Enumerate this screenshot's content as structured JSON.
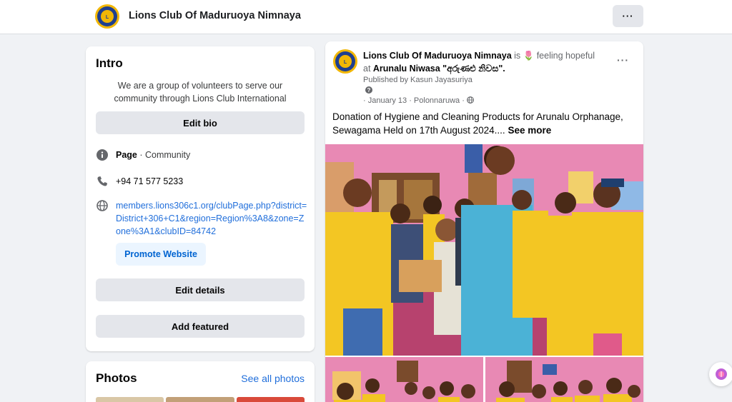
{
  "topbar": {
    "page_name": "Lions Club Of Maduruoya Nimnaya",
    "more_label": "···"
  },
  "intro": {
    "title": "Intro",
    "bio": "We are a group of volunteers to serve our community through Lions Club International",
    "edit_bio": "Edit bio",
    "category_label": "Page",
    "category_value": " · Community",
    "phone": "+94 71 577 5233",
    "website": "members.lions306c1.org/clubPage.php?district=District+306+C1&region=Region%3A8&zone=Zone%3A1&clubID=84742",
    "promote_website": "Promote Website",
    "edit_details": "Edit details",
    "add_featured": "Add featured"
  },
  "photos": {
    "title": "Photos",
    "see_all": "See all photos"
  },
  "post": {
    "author": "Lions Club Of Maduruoya Nimnaya",
    "feeling_prefix": " is ",
    "feeling_emoji": "🌷",
    "feeling": " feeling hopeful",
    "at_prefix": "at ",
    "location": "Arunalu Niwasa \"අරුණළු නිවස\".",
    "published_by": "Published by Kasun Jayasuriya",
    "help_icon_glyph": "?",
    "meta": "· January 13 · Polonnaruwa ·",
    "more_label": "···",
    "body": "Donation of Hygiene and Cleaning Products for Arunalu Orphanage, Sewagama Held on 17th August 2024....",
    "see_more": "See more"
  },
  "colors": {
    "background": "#f0f2f5",
    "link": "#216fdb",
    "button_gray": "#e4e6eb",
    "shirt_yellow": "#f3c623",
    "wall_pink": "#e889b4"
  },
  "icons": [
    "lions-logo",
    "info-icon",
    "phone-icon",
    "globe-icon",
    "more-icon",
    "globe-privacy-icon",
    "ai-assistant-icon"
  ]
}
